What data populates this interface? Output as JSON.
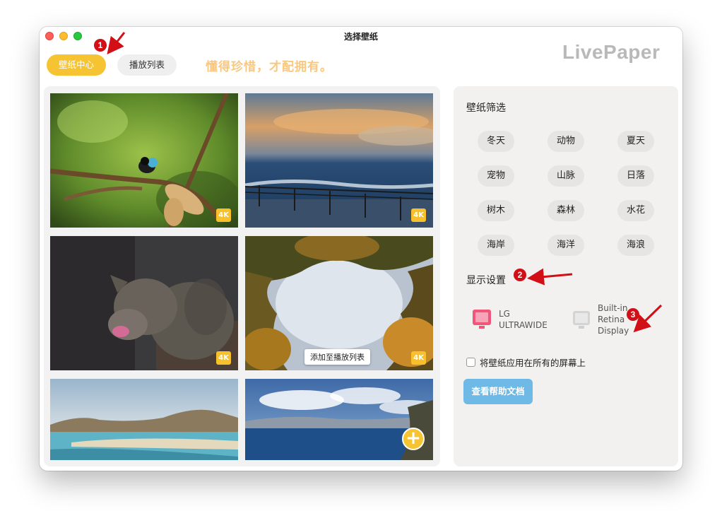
{
  "window": {
    "title": "选择壁纸"
  },
  "header": {
    "tabs": [
      {
        "label": "壁纸中心"
      },
      {
        "label": "播放列表"
      }
    ],
    "slogan": "懂得珍惜，才配拥有。",
    "logo": "LivePaper"
  },
  "gallery": {
    "badge": "4K",
    "tooltip": "添加至播放列表",
    "add_button": "+"
  },
  "filter": {
    "title": "壁纸筛选",
    "tags": [
      "冬天",
      "动物",
      "夏天",
      "宠物",
      "山脉",
      "日落",
      "树木",
      "森林",
      "水花",
      "海岸",
      "海洋",
      "海浪"
    ]
  },
  "display_settings": {
    "title": "显示设置",
    "displays": [
      {
        "line1": "LG",
        "line2": "ULTRAWIDE",
        "line3": "",
        "color": "#f0557a"
      },
      {
        "line1": "Built-in",
        "line2": "Retina",
        "line3": "Display",
        "color": "#d4d4d4"
      }
    ],
    "apply_all_label": "将壁纸应用在所有的屏幕上",
    "apply_all_checked": false,
    "help_button": "查看帮助文档"
  },
  "annotations": [
    "1",
    "2",
    "3"
  ],
  "colors": {
    "accent": "#f6c433",
    "annotation": "#d20e16",
    "help_button": "#6fb9e7"
  }
}
